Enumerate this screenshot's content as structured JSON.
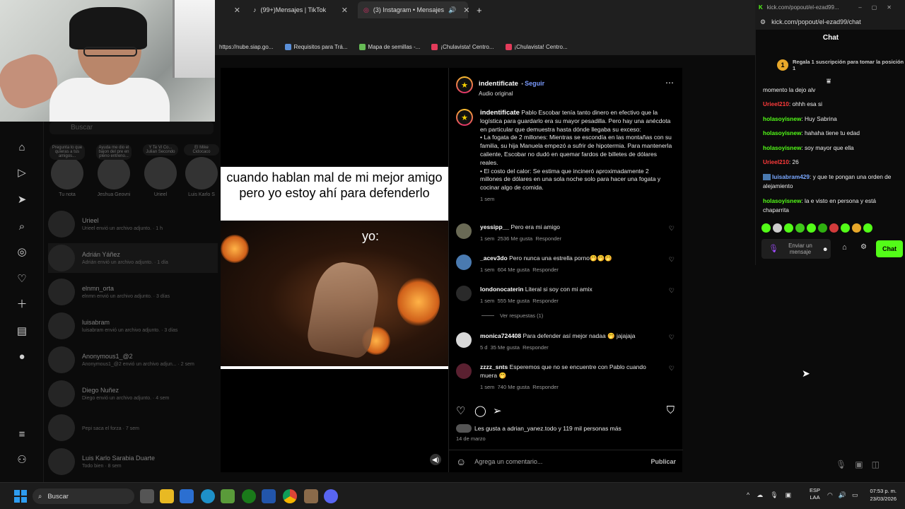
{
  "browser": {
    "tabs": [
      {
        "label": ""
      },
      {
        "label": "(99+)Mensajes | TikTok"
      },
      {
        "label": "(3) Instagram • Mensajes"
      }
    ],
    "bookmarks": [
      {
        "label": "https://nube.siap.go..."
      },
      {
        "label": "Requisitos para Trá..."
      },
      {
        "label": "Mapa de semillas -..."
      },
      {
        "label": "¡Chulavista! Centro..."
      },
      {
        "label": "¡Chulavista! Centro..."
      }
    ]
  },
  "inbox": {
    "search_placeholder": "Buscar",
    "stories": [
      {
        "note": "Pregunta lo que quieras a tus amigos...",
        "name": "Tu nota"
      },
      {
        "note": "Ayuda me dio el bajon del pre en pleno entreno...",
        "name": "Jeshua Geovni"
      },
      {
        "note": "Y Te Vi Co... Julian Secondo",
        "name": "Urieel"
      },
      {
        "note": "El Mike Cidocaco",
        "name": "Luis Karlo S"
      }
    ],
    "conversations": [
      {
        "name": "Urieel",
        "sub": "Urieel envió un archivo adjunto. · 1 h"
      },
      {
        "name": "Adrián Yáñez",
        "sub": "Adrián envió un archivo adjunto. · 1 día"
      },
      {
        "name": "elnmn_orta",
        "sub": "elnmn envió un archivo adjunto. · 3 días"
      },
      {
        "name": "luisabram",
        "sub": "luisabram envió un archivo adjunto. · 3 días"
      },
      {
        "name": "Anonymous1_@2",
        "sub": "Anonymous1_@2 envió un archivo adjun... · 2 sem"
      },
      {
        "name": "Diego Nuñez",
        "sub": "Diego envió un archivo adjunto. · 4 sem"
      },
      {
        "name": "",
        "sub": "Pepi saca el forza · 7 sem"
      },
      {
        "name": "Luis Karlo Sarabia Duarte",
        "sub": "Todo bien · 8 sem"
      }
    ]
  },
  "video": {
    "caption": "cuando hablan mal de mi mejor amigo pero yo estoy ahí para defenderlo",
    "overlay": "yo:"
  },
  "post": {
    "author": "indentificate",
    "follow": "Seguir",
    "audio": "Audio original",
    "description": [
      "Pablo Escobar tenía tanto dinero en efectivo que la logística para guardarlo era su mayor pesadilla. Pero hay una anécdota en particular que demuestra hasta dónde llegaba su exceso:",
      "• La fogata de 2 millones: Mientras se escondía en las montañas con su familia, su hija Manuela empezó a sufrir de hipotermia. Para mantenerla caliente, Escobar no dudó en quemar fardos de billetes de dólares reales.",
      "• El costo del calor: Se estima que incineró aproximadamente 2 millones de dólares en una sola noche solo para hacer una fogata y cocinar algo de comida."
    ],
    "desc_time": "1 sem",
    "comments": [
      {
        "user": "yessipp__",
        "text": "Pero era mi amigo",
        "time": "1 sem",
        "likes": "2536 Me gusta",
        "reply": "Responder"
      },
      {
        "user": "_acev3do",
        "text": "Pero nunca una estrella porno🤭🤭🤭",
        "time": "1 sem",
        "likes": "604 Me gusta",
        "reply": "Responder"
      },
      {
        "user": "londonocaterin",
        "text": "Literal si soy con mi amix",
        "time": "1 sem",
        "likes": "555 Me gusta",
        "reply": "Responder"
      },
      {
        "user": "monica724408",
        "text": "Para defender así mejor nadaa 🤭 jajajaja",
        "time": "5 d",
        "likes": "35 Me gusta",
        "reply": "Responder"
      },
      {
        "user": "zzzz_snts",
        "text": "Esperemos que no se encuentre con Pablo cuando muera 🤭",
        "time": "1 sem",
        "likes": "740 Me gusta",
        "reply": "Responder"
      }
    ],
    "view_replies": "Ver respuestas (1)",
    "likes_text": "Les gusta a adrian_yanez.todo y 119 mil personas más",
    "date": "14 de marzo",
    "comment_placeholder": "Agrega un comentario...",
    "publish": "Publicar"
  },
  "kick": {
    "tab_url": "kick.com/popout/el-ezad99...",
    "url": "kick.com/popout/el-ezad99/chat",
    "title": "Chat",
    "pinned": "Regala 1 suscripción para tomar la posición 1",
    "pinned_badge": "1",
    "messages": [
      {
        "user": "",
        "text": "momento la dejo alv",
        "color": "#ffffff"
      },
      {
        "user": "Urieel210",
        "text": ": ohhh esa si",
        "color": "#ff3b3b"
      },
      {
        "user": "holasoyisnew",
        "text": ": Huy Sabrina",
        "color": "#53fc18"
      },
      {
        "user": "holasoyisnew",
        "text": ": hahaha tiene tu edad",
        "color": "#53fc18"
      },
      {
        "user": "holasoyisnew",
        "text": ": soy mayor que ella",
        "color": "#53fc18"
      },
      {
        "user": "Urieel210",
        "text": ": 26",
        "color": "#ff3b3b"
      },
      {
        "user": "luisabram429",
        "text": ": y que te pongan una orden de alejamiento",
        "color": "#7aa8ff"
      },
      {
        "user": "holasoyisnew",
        "text": ": la e visto en persona y está chaparrita",
        "color": "#53fc18"
      }
    ],
    "input_placeholder": "Enviar un mensaje",
    "send": "Chat"
  },
  "taskbar": {
    "search": "Buscar",
    "lang": "ESP\nLAA",
    "time": "07:53 p. m.",
    "date": "23/03/2026"
  }
}
